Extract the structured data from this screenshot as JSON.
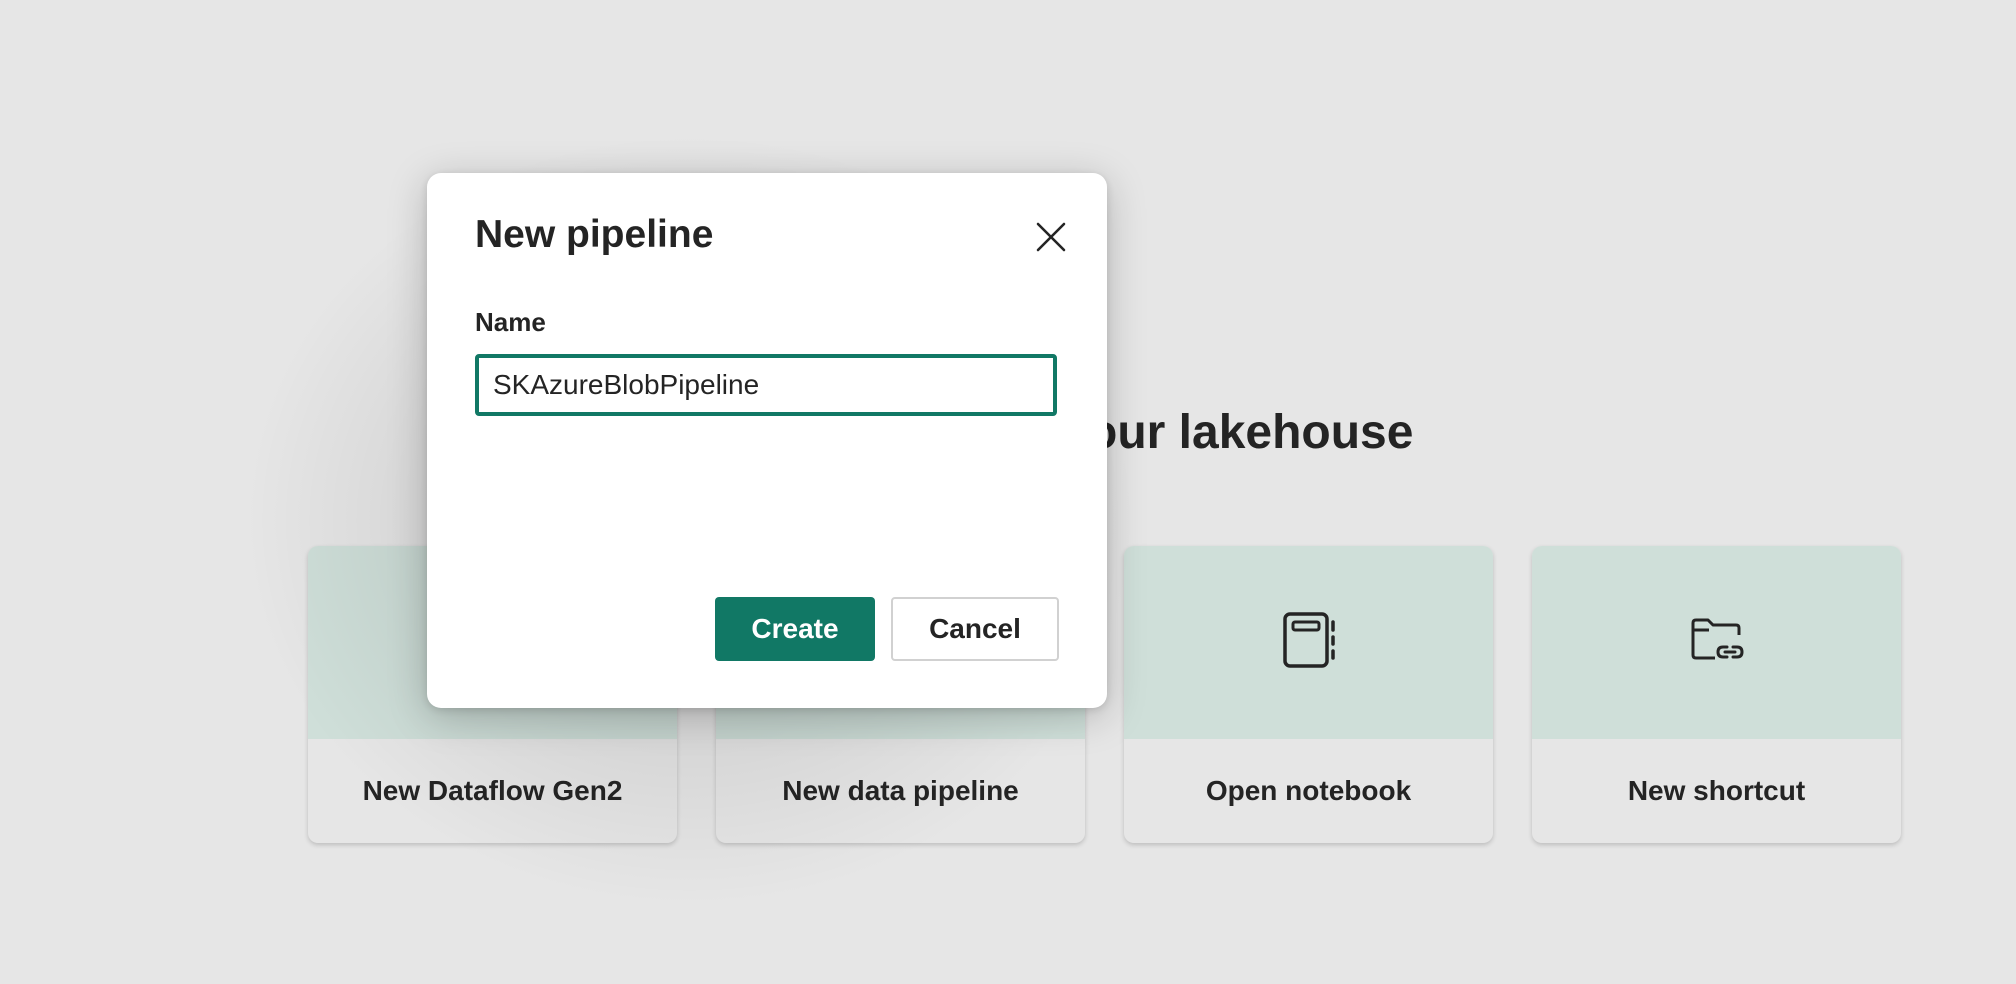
{
  "background": {
    "heading_visible": "our lakehouse"
  },
  "cards": [
    {
      "label": "New Dataflow Gen2",
      "icon": "dataflow-icon"
    },
    {
      "label": "New data pipeline",
      "icon": "pipeline-icon"
    },
    {
      "label": "Open notebook",
      "icon": "notebook-icon"
    },
    {
      "label": "New shortcut",
      "icon": "folder-link-icon"
    }
  ],
  "dialog": {
    "title": "New pipeline",
    "close_icon": "close-icon",
    "name_label": "Name",
    "name_value": "SKAzureBlobPipeline",
    "create_label": "Create",
    "cancel_label": "Cancel"
  },
  "colors": {
    "accent": "#117865",
    "card_top": "#cfdfd9",
    "page_bg": "#e6e6e6"
  }
}
